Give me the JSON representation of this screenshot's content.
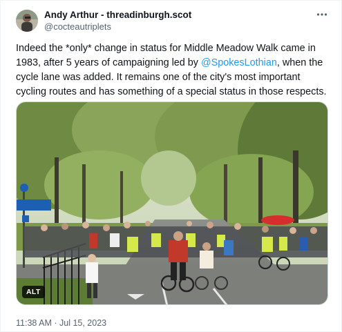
{
  "author": {
    "display_name": "Andy Arthur - threadinburgh.scot",
    "handle": "@cocteautriplets"
  },
  "tweet": {
    "text_before_mention": "Indeed the *only* change in status for Middle Meadow Walk came in 1983, after 5 years of campaigning led by ",
    "mention": "@SpokesLothian",
    "text_after_mention": ", when the cycle lane was added. It remains one of the city's most important cycling routes and has something of a special status in those respects.",
    "timestamp": "11:38 AM · Jul 15, 2023"
  },
  "media": {
    "alt_label": "ALT",
    "description_icon": "photo-of-cyclists-on-tree-lined-path"
  },
  "icons": {
    "more": "more-horizontal-icon"
  },
  "colors": {
    "text_primary": "#0f1419",
    "text_secondary": "#536471",
    "link": "#1d9bf0",
    "border": "#cfd9de"
  }
}
